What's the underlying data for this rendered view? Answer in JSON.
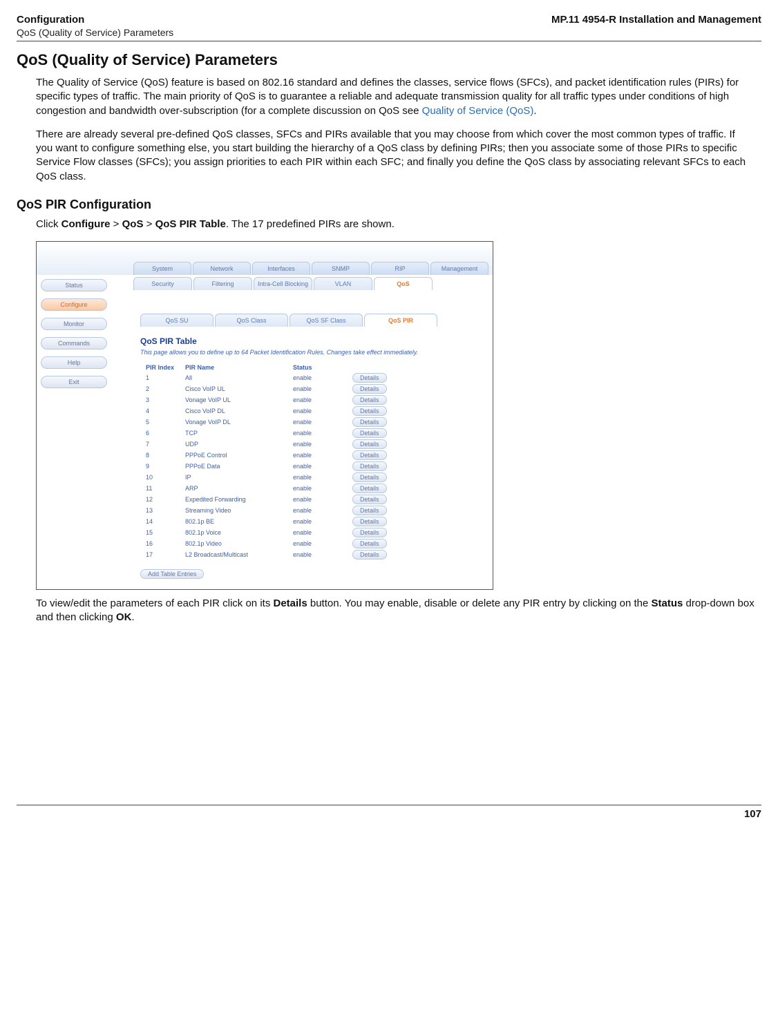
{
  "header": {
    "left": "Configuration",
    "right": "MP.11 4954-R Installation and Management",
    "sub": "QoS (Quality of Service) Parameters"
  },
  "page": {
    "h1": "QoS (Quality of Service) Parameters",
    "p1a": "The Quality of Service (QoS) feature is based on 802.16 standard and defines the classes, service flows (SFCs), and packet identification rules (PIRs) for specific types of traffic. The main priority of QoS is to guarantee a reliable and adequate transmission quality for all traffic types under conditions of high congestion and bandwidth over-subscription (for a complete discussion on QoS see ",
    "p1link": "Quality of Service (QoS)",
    "p1b": ".",
    "p2": "There are already several pre-defined QoS classes, SFCs and PIRs available that you may choose from which cover the most common types of traffic. If you want to configure something else, you start building the hierarchy of a QoS class by defining PIRs; then you associate some of those PIRs to specific Service Flow classes (SFCs); you assign priorities to each PIR within each SFC; and finally you define the QoS class by associating relevant SFCs to each QoS class.",
    "h2": "QoS PIR Configuration",
    "p3a": "Click ",
    "p3b": "Configure",
    "p3c": " > ",
    "p3d": "QoS",
    "p3e": " > ",
    "p3f": "QoS PIR Table",
    "p3g": ". The 17 predefined PIRs are shown.",
    "p4a": "To view/edit the parameters of each PIR click on its ",
    "p4b": "Details",
    "p4c": " button. You may enable, disable or delete any PIR entry by clicking on the ",
    "p4d": "Status",
    "p4e": " drop-down box and then clicking ",
    "p4f": "OK",
    "p4g": "."
  },
  "app": {
    "tabs1": [
      "System",
      "Network",
      "Interfaces",
      "SNMP",
      "RIP",
      "Management"
    ],
    "tabs2": [
      "Security",
      "Filtering",
      "Intra-Cell Blocking",
      "VLAN",
      "QoS"
    ],
    "leftnav": [
      "Status",
      "Configure",
      "Monitor",
      "Commands",
      "Help",
      "Exit"
    ],
    "leftActiveIndex": 1,
    "subtabs": [
      "QoS SU",
      "QoS Class",
      "QoS SF Class",
      "QoS PIR"
    ],
    "subActiveIndex": 3,
    "title": "QoS PIR Table",
    "desc": "This page allows you to define up to 64 Packet Identification Rules. Changes take effect immediately.",
    "cols": [
      "PIR Index",
      "PIR Name",
      "Status"
    ],
    "detailsLabel": "Details",
    "addLabel": "Add Table Entries",
    "rows": [
      {
        "i": "1",
        "n": "All",
        "s": "enable"
      },
      {
        "i": "2",
        "n": "Cisco VoIP UL",
        "s": "enable"
      },
      {
        "i": "3",
        "n": "Vonage VoIP UL",
        "s": "enable"
      },
      {
        "i": "4",
        "n": "Cisco VoIP DL",
        "s": "enable"
      },
      {
        "i": "5",
        "n": "Vonage VoIP DL",
        "s": "enable"
      },
      {
        "i": "6",
        "n": "TCP",
        "s": "enable"
      },
      {
        "i": "7",
        "n": "UDP",
        "s": "enable"
      },
      {
        "i": "8",
        "n": "PPPoE Control",
        "s": "enable"
      },
      {
        "i": "9",
        "n": "PPPoE Data",
        "s": "enable"
      },
      {
        "i": "10",
        "n": "IP",
        "s": "enable"
      },
      {
        "i": "11",
        "n": "ARP",
        "s": "enable"
      },
      {
        "i": "12",
        "n": "Expedited Forwarding",
        "s": "enable"
      },
      {
        "i": "13",
        "n": "Streaming Video",
        "s": "enable"
      },
      {
        "i": "14",
        "n": "802.1p BE",
        "s": "enable"
      },
      {
        "i": "15",
        "n": "802.1p Voice",
        "s": "enable"
      },
      {
        "i": "16",
        "n": "802.1p Video",
        "s": "enable"
      },
      {
        "i": "17",
        "n": "L2 Broadcast/Multicast",
        "s": "enable"
      }
    ]
  },
  "footer": {
    "page": "107"
  }
}
